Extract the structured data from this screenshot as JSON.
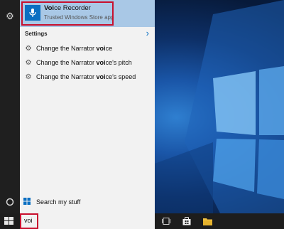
{
  "colors": {
    "accent": "#0a6fc2",
    "highlight": "#a9c8e6",
    "annotation": "#c8102e"
  },
  "top_result": {
    "title_bold": "Voi",
    "title_rest": "ce Recorder",
    "subtitle": "Trusted Windows Store app",
    "icon": "voice-recorder-icon"
  },
  "settings": {
    "header": "Settings",
    "items": [
      {
        "pre": "Change the Narrator ",
        "bold": "voi",
        "post": "ce"
      },
      {
        "pre": "Change the Narrator ",
        "bold": "voi",
        "post": "ce's pitch"
      },
      {
        "pre": "Change the Narrator ",
        "bold": "voi",
        "post": "ce's speed"
      }
    ]
  },
  "search_my_stuff": "Search my stuff",
  "search": {
    "query": "voi"
  },
  "taskbar_icons": [
    "task-view-icon",
    "store-icon",
    "file-explorer-icon"
  ]
}
